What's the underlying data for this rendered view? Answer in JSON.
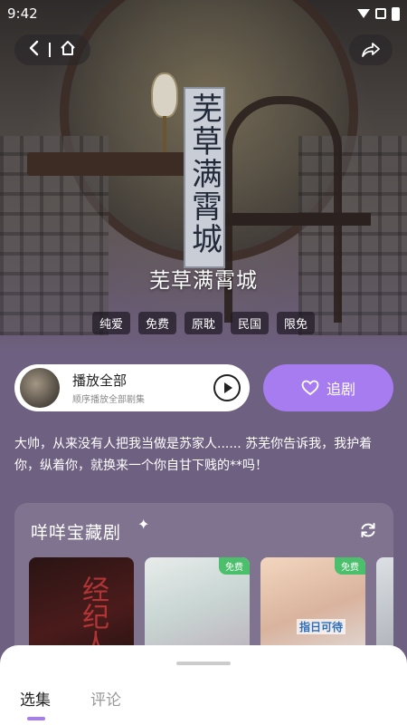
{
  "status_bar": {
    "time": "9:42"
  },
  "poster": {
    "scroll_text": "芜草满霄城"
  },
  "drama": {
    "title": "芜草满霄城",
    "tags": [
      "纯爱",
      "免费",
      "原耽",
      "民国",
      "限免"
    ]
  },
  "play_all": {
    "label": "播放全部",
    "sub": "顺序播放全部剧集"
  },
  "follow": {
    "label": "追剧"
  },
  "description": "大帅，从来没有人把我当做是苏家人...... 苏芜你告诉我，我护着你，纵着你，就换来一个你自甘下贱的**吗！",
  "treasure": {
    "title": "咩咩宝藏剧",
    "cards": [
      {
        "badge": "",
        "cover_text": "经纪人"
      },
      {
        "badge": "免费",
        "cover_text": ""
      },
      {
        "badge": "免费",
        "cover_text": "指日可待"
      }
    ]
  },
  "bottom_tabs": [
    "选集",
    "评论"
  ],
  "colors": {
    "accent": "#a77cf0",
    "badge_green": "#4bbf6b",
    "bg": "#6e6080"
  },
  "icons": [
    "back-icon",
    "home-icon",
    "share-icon",
    "play-icon",
    "heart-icon",
    "sparkle-icon",
    "refresh-icon"
  ]
}
